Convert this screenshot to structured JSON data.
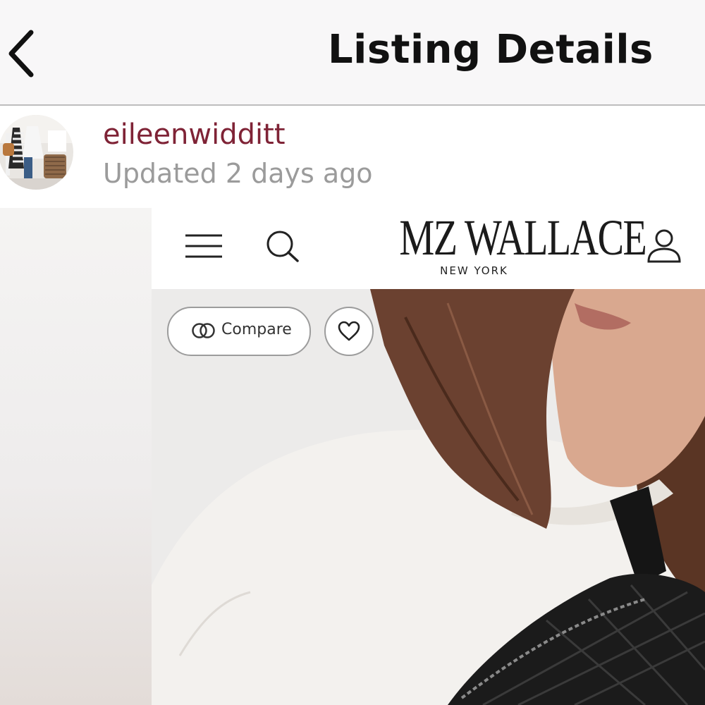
{
  "header": {
    "title": "Listing Details",
    "back_icon": "chevron-left-icon"
  },
  "seller": {
    "username": "eileenwidditt",
    "updated": "Updated 2 days ago"
  },
  "listing_image": {
    "site": {
      "brand": "MZ WALLACE",
      "brand_sub": "NEW YORK",
      "menu_icon": "menu-icon",
      "search_icon": "search-icon",
      "account_icon": "user-icon"
    },
    "compare_label": "Compare",
    "favorite_icon": "heart-icon"
  },
  "colors": {
    "username": "#7f2336",
    "muted_text": "#9b9b9b",
    "top_bar": "#f8f7f8"
  }
}
